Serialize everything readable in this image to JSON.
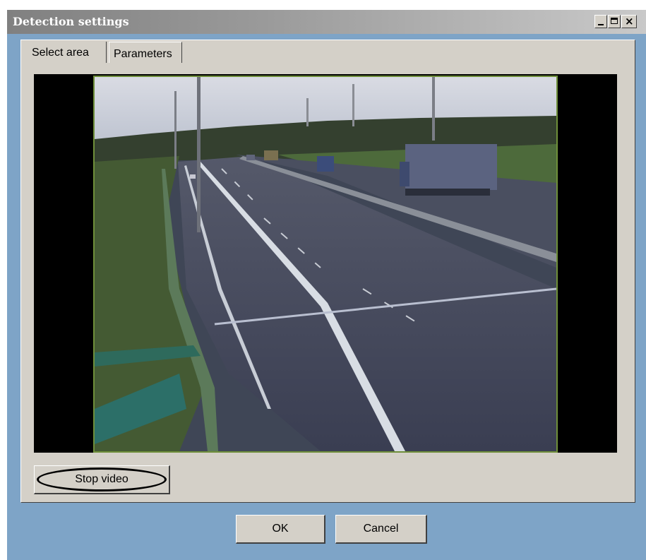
{
  "window": {
    "title": "Detection settings",
    "controls": {
      "minimize": "minimize-icon",
      "maximize": "maximize-icon",
      "close": "close-icon"
    },
    "colors": {
      "dialog_bg": "#7ea4c7",
      "panel_bg": "#d4d0c8",
      "frame_border": "#6f8f3a"
    }
  },
  "tabs": [
    {
      "label": "Select area",
      "active": true
    },
    {
      "label": "Parameters",
      "active": false
    }
  ],
  "video": {
    "content": "highway-camera-feed"
  },
  "buttons": {
    "stop_video": "Stop video",
    "ok": "OK",
    "cancel": "Cancel"
  }
}
